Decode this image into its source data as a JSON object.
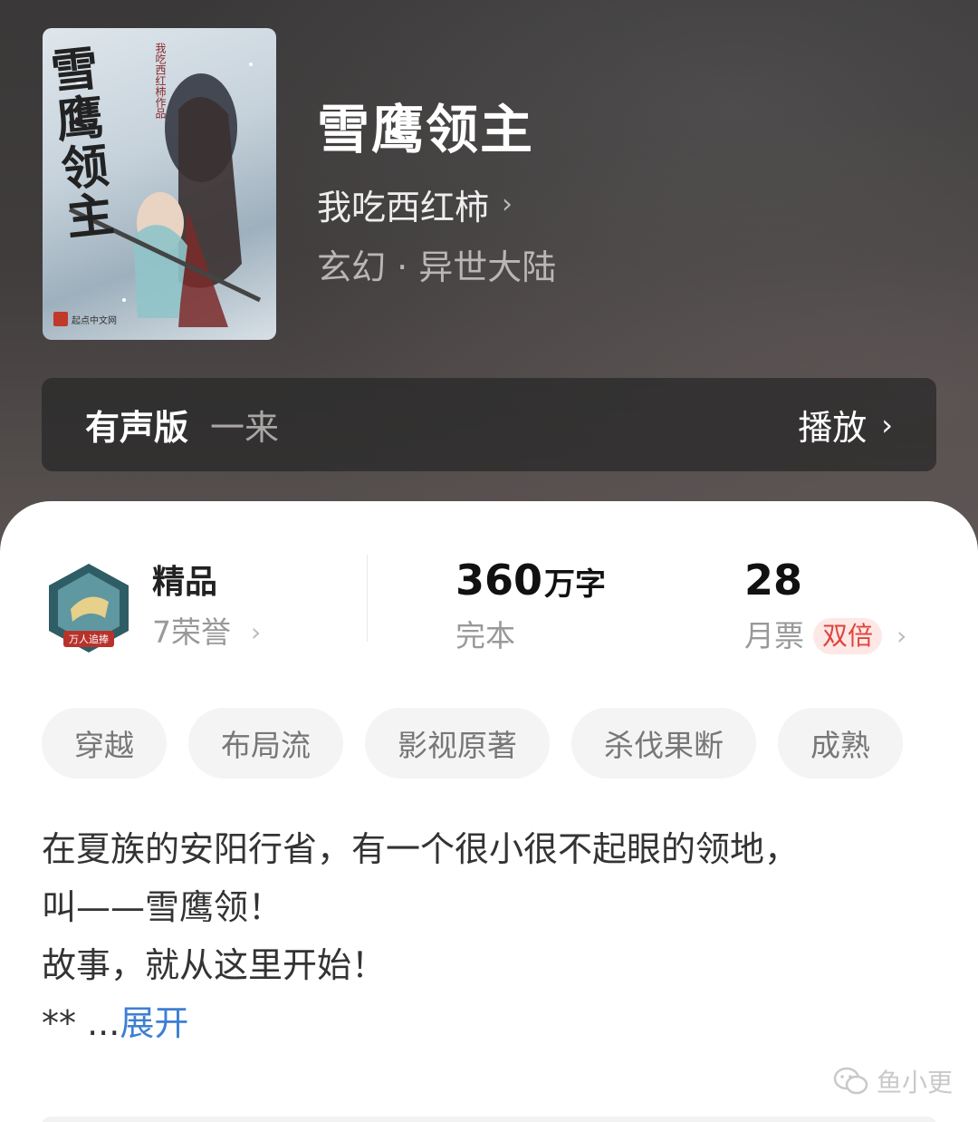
{
  "book": {
    "title": "雪鹰领主",
    "author": "我吃西红柿",
    "genre": "玄幻 · 异世大陆",
    "cover": {
      "title_art": "雪鹰领主",
      "author_art": "我吃西红柿作品",
      "publisher": "起点中文网"
    }
  },
  "audio": {
    "label": "有声版",
    "narrator": "一来",
    "play_label": "播放"
  },
  "stats": {
    "honor": {
      "title": "精品",
      "subtitle": "7荣誉",
      "badge_text": "万人追捧"
    },
    "words": {
      "number": "360",
      "unit": "万字",
      "status": "完本"
    },
    "votes": {
      "number": "28",
      "label": "月票",
      "badge": "双倍"
    }
  },
  "tags": [
    "穿越",
    "布局流",
    "影视原著",
    "杀伐果断",
    "成熟"
  ],
  "description": {
    "lines": [
      "在夏族的安阳行省，有一个很小很不起眼的领地，",
      "叫——雪鹰领！",
      "故事，就从这里开始！"
    ],
    "last_line_prefix": "** ...",
    "expand_label": "展开"
  },
  "watermark": {
    "text": "鱼小更"
  },
  "icons": {
    "author_chevron": "chevron-right-icon",
    "play_chevron": "chevron-right-icon",
    "honor_chevron": "chevron-right-icon",
    "votes_chevron": "chevron-right-icon",
    "watermark": "wechat-icon"
  },
  "colors": {
    "accent_link": "#3d7fd3",
    "badge_red": "#e0453d",
    "header_bg": "#3a3838"
  }
}
